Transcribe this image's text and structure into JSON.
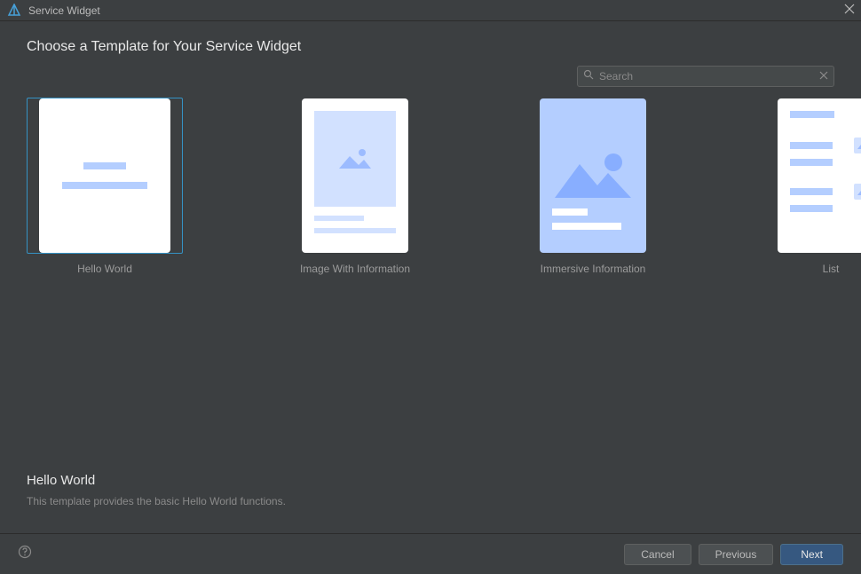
{
  "window": {
    "title": "Service Widget"
  },
  "heading": "Choose a Template for Your Service Widget",
  "search": {
    "placeholder": "Search",
    "value": ""
  },
  "templates": [
    {
      "label": "Hello World",
      "selected": true
    },
    {
      "label": "Image With Information",
      "selected": false
    },
    {
      "label": "Immersive Information",
      "selected": false
    },
    {
      "label": "List",
      "selected": false
    }
  ],
  "description": {
    "title": "Hello World",
    "text": "This template provides the basic Hello World functions."
  },
  "footer": {
    "cancel": "Cancel",
    "previous": "Previous",
    "next": "Next"
  }
}
